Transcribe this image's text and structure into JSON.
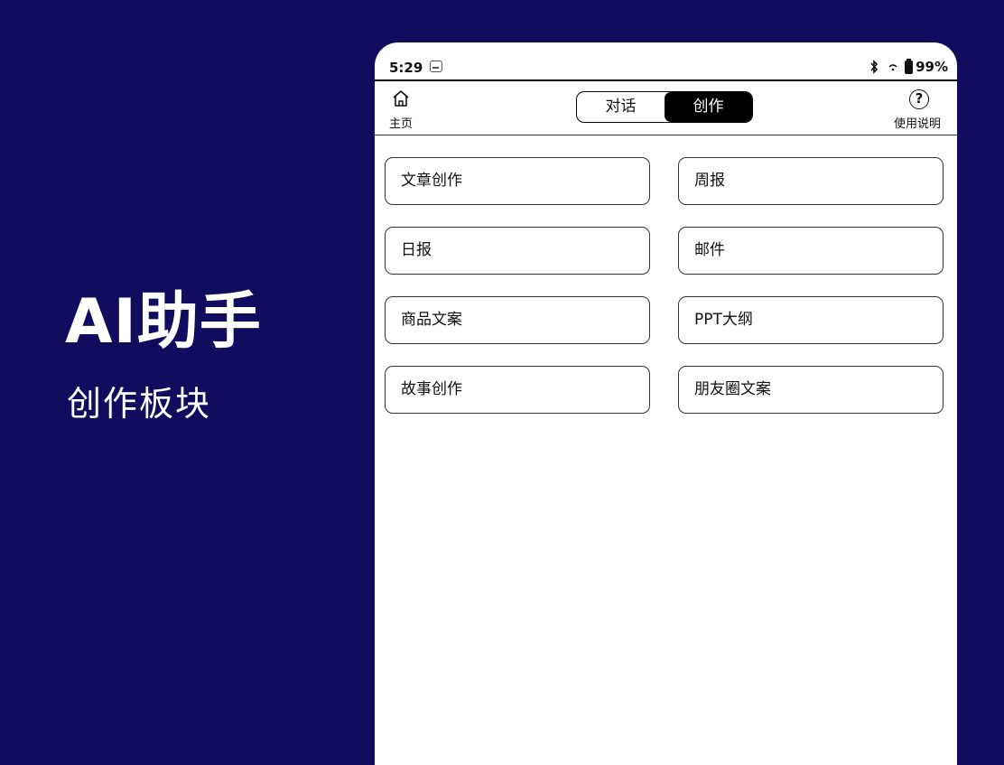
{
  "promo": {
    "title": "AI助手",
    "subtitle": "创作板块"
  },
  "colors": {
    "background": "#110c5e",
    "device": "#ffffff",
    "active_tab": "#000000"
  },
  "status_bar": {
    "time": "5:29",
    "battery": "99%"
  },
  "header": {
    "home_label": "主页",
    "help_label": "使用说明",
    "help_glyph": "?",
    "tabs": [
      {
        "label": "对话",
        "active": false
      },
      {
        "label": "创作",
        "active": true
      }
    ]
  },
  "cards": [
    {
      "label": "文章创作"
    },
    {
      "label": "周报"
    },
    {
      "label": "日报"
    },
    {
      "label": "邮件"
    },
    {
      "label": "商品文案"
    },
    {
      "label": "PPT大纲"
    },
    {
      "label": "故事创作"
    },
    {
      "label": "朋友圈文案"
    }
  ]
}
